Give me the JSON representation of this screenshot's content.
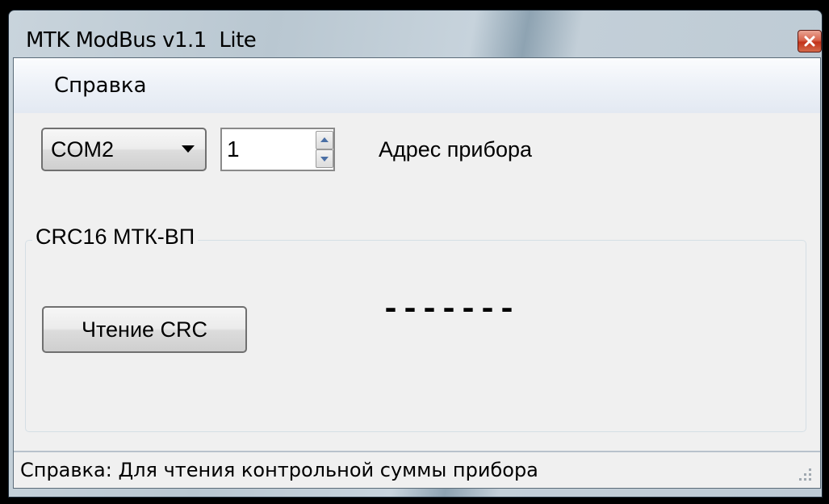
{
  "window": {
    "title": "MTK ModBus v1.1  Lite",
    "close_icon": "close-icon"
  },
  "menu": {
    "items": [
      {
        "label": "Справка"
      }
    ]
  },
  "toolbar": {
    "port": {
      "selected": "COM2",
      "icon": "chevron-down-icon"
    },
    "address": {
      "value": "1",
      "label": "Адрес прибора"
    }
  },
  "crc_group": {
    "title": "CRC16 МТК-ВП",
    "read_button_label": "Чтение CRC",
    "value": "-------"
  },
  "status": {
    "text": "Справка: Для чтения контрольной суммы прибора"
  },
  "colors": {
    "client_bg": "#f0f0f0",
    "close_button": "#c2321a",
    "spin_arrow": "#4a6fa5"
  }
}
